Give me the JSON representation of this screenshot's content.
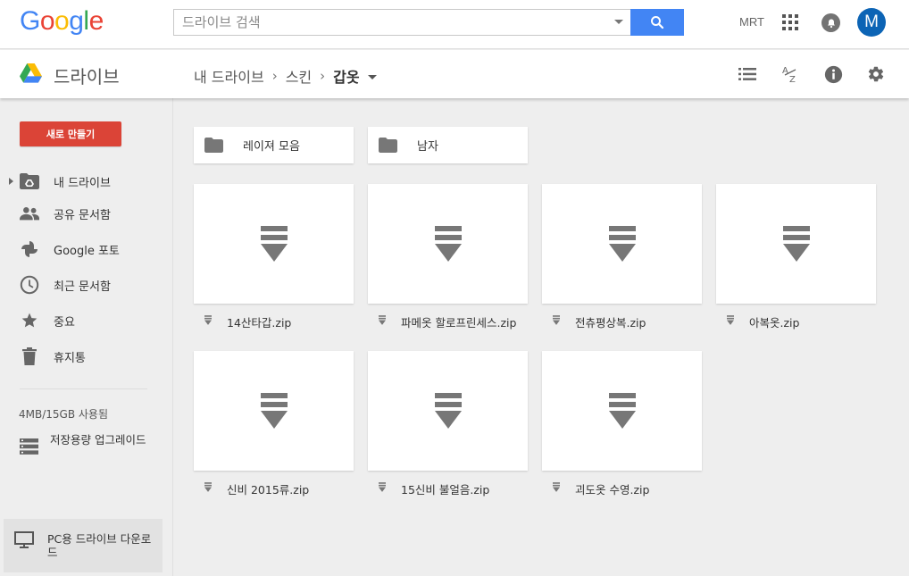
{
  "header": {
    "logo_letters": [
      {
        "ch": "G",
        "color": "#4285f4"
      },
      {
        "ch": "o",
        "color": "#ea4335"
      },
      {
        "ch": "o",
        "color": "#fbbc05"
      },
      {
        "ch": "g",
        "color": "#4285f4"
      },
      {
        "ch": "l",
        "color": "#34a853"
      },
      {
        "ch": "e",
        "color": "#ea4335"
      }
    ],
    "search_placeholder": "드라이브 검색",
    "account_name": "MRT",
    "avatar_initial": "M",
    "search_button_color": "#4285f4",
    "avatar_color": "#0c64b5"
  },
  "subbar": {
    "title": "드라이브",
    "breadcrumb": [
      "내 드라이브",
      "스킨",
      "갑옷"
    ]
  },
  "sidebar": {
    "new_button": "새로 만들기",
    "new_button_color": "#db4437",
    "items": [
      {
        "label": "내 드라이브",
        "icon": "my-drive-icon"
      },
      {
        "label": "공유 문서함",
        "icon": "shared-icon"
      },
      {
        "label": "Google 포토",
        "icon": "photos-icon"
      },
      {
        "label": "최근 문서함",
        "icon": "recent-icon"
      },
      {
        "label": "중요",
        "icon": "star-icon"
      },
      {
        "label": "휴지통",
        "icon": "trash-icon"
      }
    ],
    "storage": "4MB/15GB 사용됨",
    "upgrade": "저장용량 업그레이드",
    "pc_download": "PC용 드라이브 다운로드"
  },
  "folders": [
    {
      "name": "레이져 모음"
    },
    {
      "name": "남자"
    }
  ],
  "files": [
    {
      "name": "14산타갑.zip"
    },
    {
      "name": "파메옷 할로프린세스.zip"
    },
    {
      "name": "전츄평상복.zip"
    },
    {
      "name": "아복옷.zip"
    },
    {
      "name": "신비 2015류.zip"
    },
    {
      "name": "15신비 불얼음.zip"
    },
    {
      "name": "괴도옷 수영.zip"
    }
  ]
}
